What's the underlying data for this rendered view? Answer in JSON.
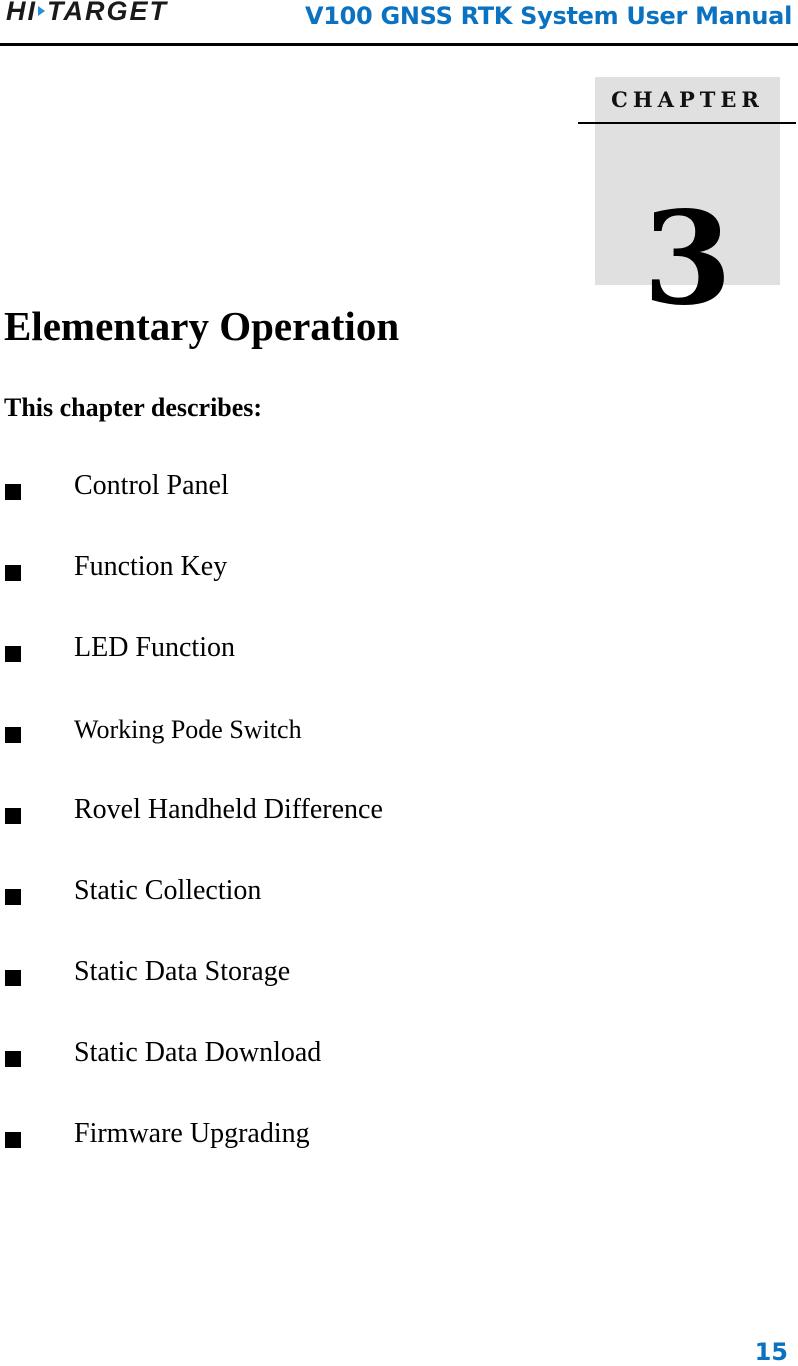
{
  "header": {
    "logo_left": "HI",
    "logo_right": "TARGET",
    "logo_arrow_icon": "play-triangle-icon",
    "title": "V100 GNSS RTK System User Manual",
    "accent_color": "#0a72c0"
  },
  "chapter": {
    "label": "CHAPTER",
    "number": "3"
  },
  "main": {
    "heading": "Elementary Operation",
    "intro": "This chapter describes:",
    "bullet_icon": "black-square-icon",
    "items": [
      {
        "label": "Control Panel"
      },
      {
        "label": "Function Key"
      },
      {
        "label": "LED Function"
      },
      {
        "label": "Working Pode Switch"
      },
      {
        "label": "Rovel Handheld Difference"
      },
      {
        "label": "Static Collection"
      },
      {
        "label": "Static Data Storage"
      },
      {
        "label": "Static Data Download"
      },
      {
        "label": "Firmware Upgrading"
      }
    ]
  },
  "footer": {
    "page_number": "15"
  }
}
